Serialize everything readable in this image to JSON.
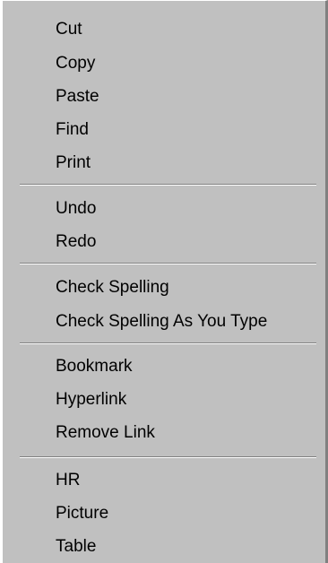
{
  "context_menu": {
    "groups": [
      {
        "items": [
          {
            "label": "Cut"
          },
          {
            "label": "Copy"
          },
          {
            "label": "Paste"
          },
          {
            "label": "Find"
          },
          {
            "label": "Print"
          }
        ]
      },
      {
        "items": [
          {
            "label": "Undo"
          },
          {
            "label": "Redo"
          }
        ]
      },
      {
        "items": [
          {
            "label": "Check Spelling"
          },
          {
            "label": "Check Spelling As You Type"
          }
        ]
      },
      {
        "items": [
          {
            "label": "Bookmark"
          },
          {
            "label": "Hyperlink"
          },
          {
            "label": "Remove Link"
          }
        ]
      },
      {
        "items": [
          {
            "label": "HR"
          },
          {
            "label": "Picture"
          },
          {
            "label": "Table"
          }
        ]
      }
    ]
  }
}
